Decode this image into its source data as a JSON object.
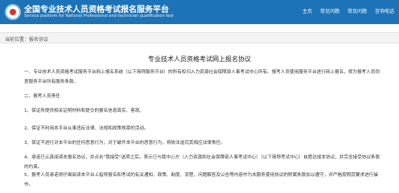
{
  "header": {
    "title": "全国专业技术人员资格考试报名服务平台",
    "subtitle": "Service platform for National Professional and technician qualification test",
    "nav": [
      "主页",
      "常见问题",
      "常见问题",
      "咨询电话"
    ]
  },
  "breadcrumb": {
    "prefix": "当前位置：",
    "current": "报名协议"
  },
  "doc": {
    "title": "专业技术人员资格考试网上报名协议",
    "p1": "一、专业技术人员资格考试服务平台网上报名系统（以下简称服务平台）的所有权归入力资源社会保障部人事考试中心所有。报考人员使用服务平台进行网上报名，视为报考人员同意服务平台所有服务条款。",
    "p2": "二、报考人员责任",
    "p3": "1、保证所提供相关证明材料和提交的报名信息真实、客观。",
    "p4": "2、保证不利用本平台从事违反法律、法规和政策规章的活动。",
    "p5": "3、保证不进行对本平台的任何恶意行为，对于破坏本平台的恶意行为，将依法追究其相应法律责任。",
    "p6": "4、承诺已认真阅读本报名协议，并点击\"我接受\"选项之后，表示已与我中心方（人力资源和社会保障部人事考试中心）（以下简称考试中心）自愿达成本协议，并完全接受协议条款的约束。",
    "p7": "5、报考人员承诺将仔细阅读本平台上指导报名和考试的有关通知、政策、制度、流程、问题解答及公告等内容作为本服务使用协议的附属条款加以遵守，并严格按照其要求进行操作。"
  }
}
